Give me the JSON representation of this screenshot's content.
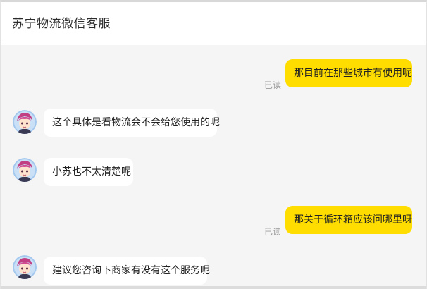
{
  "header": {
    "title": "苏宁物流微信客服"
  },
  "messages": [
    {
      "direction": "out",
      "text": "那目前在那些城市有使用呢",
      "status": "已读"
    },
    {
      "direction": "in",
      "text": "这个具体是看物流会不会给您使用的呢",
      "avatar": "agent-avatar-icon"
    },
    {
      "direction": "in",
      "text": "小苏也不太清楚呢",
      "avatar": "agent-avatar-icon"
    },
    {
      "direction": "out",
      "text": "那关于循环箱应该问哪里呀",
      "status": "已读"
    },
    {
      "direction": "in",
      "text": "建议您咨询下商家有没有这个服务呢",
      "avatar": "agent-avatar-icon"
    }
  ],
  "colors": {
    "outgoing_bubble": "#ffdd00",
    "incoming_bubble": "#ffffff",
    "chat_background": "#f5f5f5"
  }
}
